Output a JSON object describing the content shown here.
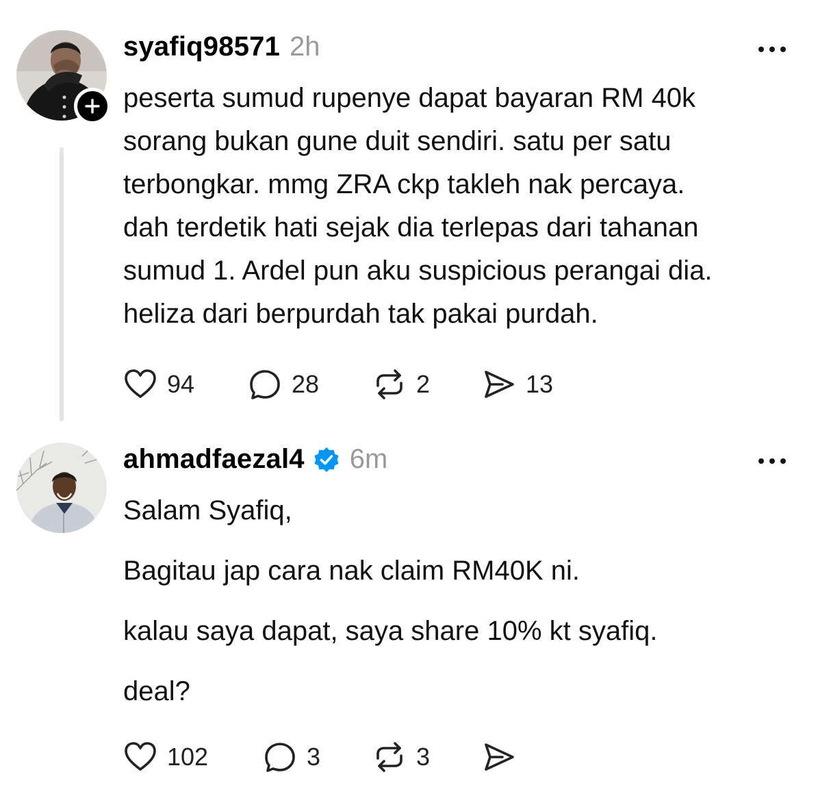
{
  "thread": {
    "post1": {
      "username": "syafiq98571",
      "time": "2h",
      "lines": [
        "peserta sumud rupenye dapat bayaran RM 40k",
        "sorang bukan gune duit sendiri. satu per satu",
        "terbongkar. mmg ZRA ckp takleh nak percaya.",
        "dah terdetik hati sejak dia terlepas dari tahanan",
        "sumud 1. Ardel pun aku suspicious perangai dia.",
        "heliza dari berpurdah tak pakai purdah."
      ],
      "likes": "94",
      "replies": "28",
      "reposts": "2",
      "shares": "13"
    },
    "post2": {
      "username": "ahmadfaezal4",
      "time": "6m",
      "verified": true,
      "paragraphs": [
        "Salam Syafiq,",
        "Bagitau jap cara nak claim RM40K ni.",
        "kalau saya dapat, saya share 10% kt syafiq.",
        "deal?"
      ],
      "likes": "102",
      "replies": "3",
      "reposts": "3"
    }
  },
  "icons": {
    "like": "heart-icon",
    "reply": "comment-bubble-icon",
    "repost": "repost-arrows-icon",
    "share": "send-paper-plane-icon",
    "more": "more-horizontal-icon",
    "follow": "plus-icon",
    "verified": "verified-badge-icon"
  },
  "colors": {
    "verified": "#0095f6",
    "timestamp": "#999999",
    "thread_line": "#e3e3e3"
  }
}
